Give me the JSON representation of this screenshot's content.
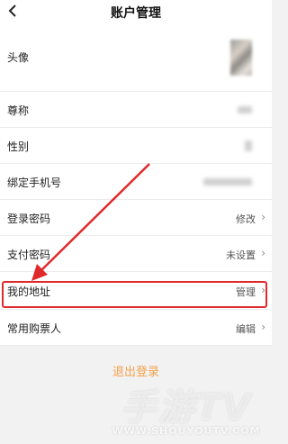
{
  "header": {
    "title": "账户管理"
  },
  "rows": [
    {
      "label": "头像"
    },
    {
      "label": "尊称"
    },
    {
      "label": "性别"
    },
    {
      "label": "绑定手机号"
    },
    {
      "label": "登录密码",
      "value": "修改"
    },
    {
      "label": "支付密码",
      "value": "未设置"
    },
    {
      "label": "我的地址",
      "value": "管理"
    },
    {
      "label": "常用购票人",
      "value": "编辑"
    }
  ],
  "actions": {
    "logout": "退出登录"
  },
  "watermark": {
    "title": "手游TV",
    "sub": "WWW.SHOUYOUTV.COM"
  },
  "colors": {
    "highlight": "#e0292b",
    "logout": "#f4a04a"
  }
}
